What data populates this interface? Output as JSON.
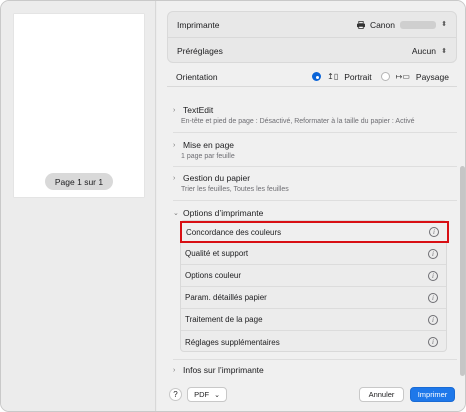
{
  "preview": {
    "page_indicator": "Page 1 sur 1"
  },
  "printer": {
    "label": "Imprimante",
    "value": "Canon"
  },
  "presets": {
    "label": "Préréglages",
    "value": "Aucun"
  },
  "orientation": {
    "label": "Orientation",
    "portrait": "Portrait",
    "landscape": "Paysage",
    "selected": "Portrait"
  },
  "sections": {
    "textedit": {
      "title": "TextEdit",
      "subtitle": "En-tête et pied de page : Désactivé, Reformater à la taille du papier : Activé"
    },
    "layout": {
      "title": "Mise en page",
      "subtitle": "1 page par feuille"
    },
    "paper": {
      "title": "Gestion du papier",
      "subtitle": "Trier les feuilles, Toutes les feuilles"
    },
    "printer_options": {
      "title": "Options d’imprimante",
      "items": [
        "Concordance des couleurs",
        "Qualité et support",
        "Options couleur",
        "Param. détaillés papier",
        "Traitement de la page",
        "Réglages supplémentaires"
      ]
    },
    "printer_info": {
      "title": "Infos sur l’imprimante"
    }
  },
  "footer": {
    "help": "?",
    "pdf": "PDF",
    "cancel": "Annuler",
    "print": "Imprimer"
  },
  "colors": {
    "accent": "#1e78ea",
    "highlight": "#d80f14"
  }
}
